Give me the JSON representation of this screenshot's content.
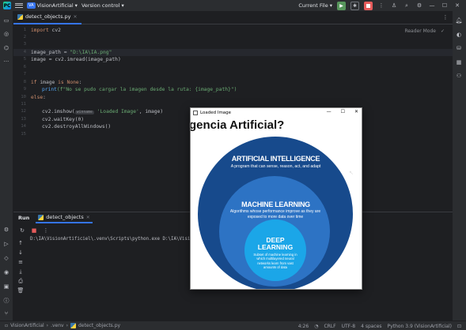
{
  "titlebar": {
    "project_badge": "VA",
    "project_name": "VisionArtificial",
    "vcs": "Version control",
    "run_config": "Current File"
  },
  "editor": {
    "tab_label": "detect_objects.py",
    "reader_mode": "Reader Mode",
    "lines": [
      {
        "num": "1",
        "text": ""
      },
      {
        "num": "2",
        "text": ""
      },
      {
        "num": "3",
        "text": ""
      },
      {
        "num": "4",
        "text": ""
      },
      {
        "num": "5",
        "text": ""
      },
      {
        "num": "6",
        "text": ""
      },
      {
        "num": "7",
        "text": ""
      },
      {
        "num": "8",
        "text": ""
      },
      {
        "num": "9",
        "text": ""
      },
      {
        "num": "10",
        "text": ""
      },
      {
        "num": "11",
        "text": ""
      },
      {
        "num": "12",
        "text": ""
      },
      {
        "num": "13",
        "text": ""
      },
      {
        "num": "14",
        "text": ""
      },
      {
        "num": "15",
        "text": ""
      }
    ],
    "code": {
      "import_kw": "import",
      "import_mod": " cv2",
      "image_path_var": "image_path = ",
      "image_path_val": "\"D:\\IA\\IA.png\"",
      "imread_line": "image = cv2.imread(image_path)",
      "if_kw": "if",
      "if_rest": " image ",
      "is_kw": "is",
      "none_kw": " None",
      "if_colon": ":",
      "print_fn": "print",
      "print_str": "(f\"No se pudo cargar la imagen desde la ruta: {image_path}\")",
      "else_kw": "else",
      "else_colon": ":",
      "imshow_pre": "cv2.imshow(",
      "imshow_hint": "winname",
      "imshow_str": " 'Loaded Image'",
      "imshow_post": ", image)",
      "waitkey": "cv2.waitKey(0)",
      "destroy": "cv2.destroyAllWindows()"
    }
  },
  "run_panel": {
    "title": "Run",
    "tab_label": "detect_objects",
    "console_line": "D:\\IA\\VisionArtificiel\\.venv\\Scripts\\python.exe D:\\IA\\Visio"
  },
  "statusbar": {
    "crumbs": [
      "VisionArtificial",
      ".venv",
      "detect_objects.py"
    ],
    "position": "4:26",
    "line_ending": "CRLF",
    "encoding": "UTF-8",
    "indent": "4 spaces",
    "interpreter": "Python 3.9 (VisionArtificial)"
  },
  "image_window": {
    "title": "Loaded Image",
    "headline": "gencia Artificial?",
    "ai_heading": "ARTIFICIAL INTELLIGENCE",
    "ai_sub": "A program that can sense, reason, act, and adapt",
    "ml_heading": "MACHINE LEARNING",
    "ml_sub": "Algorithms whose performance improve as they are exposed to more data over time",
    "dl_heading": "DEEP LEARNING",
    "dl_sub": "Subset of machine learning in which multilayered neural networks learn from vast amounts of data"
  }
}
